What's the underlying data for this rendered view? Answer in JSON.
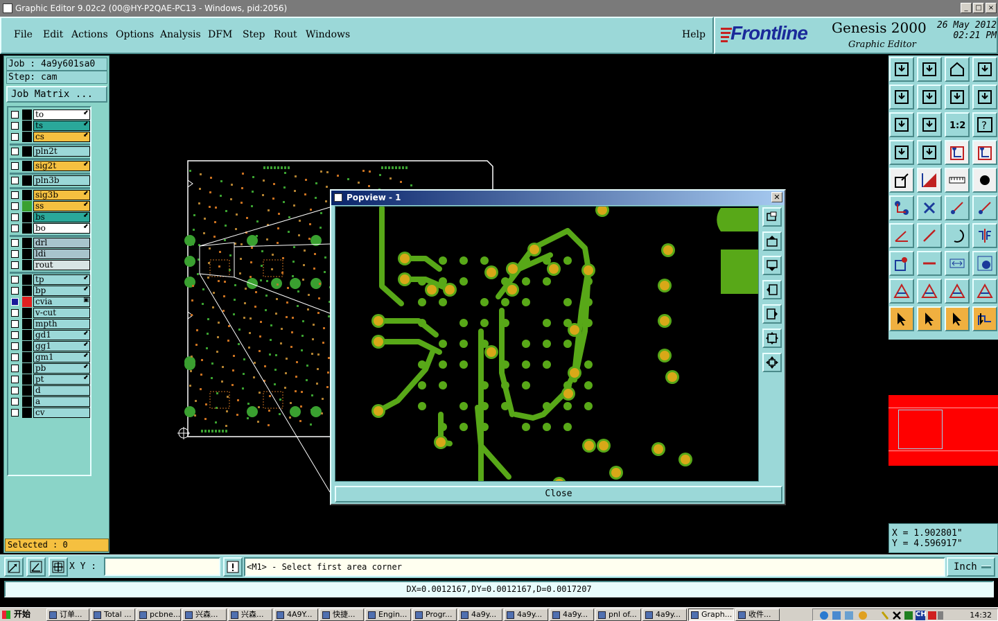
{
  "window": {
    "title": "Graphic Editor 9.02c2 (00@HY-P2QAE-PC13 - Windows, pid:2056)",
    "controls": [
      "_",
      "□",
      "×"
    ]
  },
  "menu": {
    "items": [
      "File",
      "Edit",
      "Actions",
      "Options",
      "Analysis",
      "DFM",
      "Step",
      "Rout",
      "Windows"
    ],
    "help": "Help"
  },
  "brand": {
    "logo": "Frontline",
    "product": "Genesis 2000",
    "subtitle": "Graphic Editor",
    "date": "26 May 2012",
    "time": "02:21 PM"
  },
  "job": {
    "job_label": "Job : 4a9y601sa0",
    "step_label": "Step: cam",
    "matrix_button": "Job Matrix ..."
  },
  "layers": [
    {
      "name": "to",
      "color": "#ffffff",
      "sw": "#000000",
      "arrow": true
    },
    {
      "name": "ts",
      "color": "#2aa89a",
      "sw": "#000000",
      "arrow": true
    },
    {
      "name": "cs",
      "color": "#f5c040",
      "sw": "#000000",
      "arrow": true
    },
    {
      "name": "pln2t",
      "color": "#9bd8d8",
      "sw": "#000000",
      "arrow": false
    },
    {
      "name": "sig2t",
      "color": "#f5c040",
      "sw": "#000000",
      "arrow": true
    },
    {
      "name": "pln3b",
      "color": "#9bd8d8",
      "sw": "#000000",
      "arrow": false
    },
    {
      "name": "sig3b",
      "color": "#f5c040",
      "sw": "#000000",
      "arrow": true
    },
    {
      "name": "ss",
      "color": "#f5c040",
      "sw": "#3aa030",
      "arrow": true
    },
    {
      "name": "bs",
      "color": "#2aa89a",
      "sw": "#000000",
      "arrow": true
    },
    {
      "name": "bo",
      "color": "#ffffff",
      "sw": "#000000",
      "arrow": true
    },
    {
      "name": "drl",
      "color": "#a8c4cc",
      "sw": "#000000",
      "arrow": false
    },
    {
      "name": "ldi",
      "color": "#a8c4cc",
      "sw": "#000000",
      "arrow": false
    },
    {
      "name": "rout",
      "color": "#d8e4e4",
      "sw": "#000000",
      "arrow": false
    },
    {
      "name": "tp",
      "color": "#9bd8d8",
      "sw": "#000000",
      "arrow": true
    },
    {
      "name": "bp",
      "color": "#9bd8d8",
      "sw": "#000000",
      "arrow": true
    },
    {
      "name": "cvia",
      "color": "#9bd8d8",
      "sw": "#e02020",
      "arrow": true,
      "active": true
    },
    {
      "name": "v-cut",
      "color": "#9bd8d8",
      "sw": "#000000",
      "arrow": false
    },
    {
      "name": "mpth",
      "color": "#9bd8d8",
      "sw": "#000000",
      "arrow": false
    },
    {
      "name": "gd1",
      "color": "#9bd8d8",
      "sw": "#000000",
      "arrow": true
    },
    {
      "name": "gg1",
      "color": "#9bd8d8",
      "sw": "#000000",
      "arrow": true
    },
    {
      "name": "gm1",
      "color": "#9bd8d8",
      "sw": "#000000",
      "arrow": true
    },
    {
      "name": "pb",
      "color": "#9bd8d8",
      "sw": "#000000",
      "arrow": true
    },
    {
      "name": "pt",
      "color": "#9bd8d8",
      "sw": "#000000",
      "arrow": true
    },
    {
      "name": "d",
      "color": "#9bd8d8",
      "sw": "#000000",
      "arrow": false
    },
    {
      "name": "a",
      "color": "#9bd8d8",
      "sw": "#000000",
      "arrow": false
    },
    {
      "name": "cv",
      "color": "#9bd8d8",
      "sw": "#000000",
      "arrow": false
    }
  ],
  "selected": "Selected : 0",
  "popview": {
    "title": "Popview - 1",
    "close_button": "Close"
  },
  "coords": {
    "x": "X = 1.902801\"",
    "y": "Y = 4.596917\""
  },
  "command": {
    "xy_label": "X Y :",
    "xy_value": "",
    "prompt": "<M1> - Select first area corner",
    "units": "Inch"
  },
  "measure": "DX=0.0012167,DY=0.0012167,D=0.0017207",
  "taskbar": {
    "start": "开始",
    "items": [
      "订单...",
      "Total ...",
      "pcbne...",
      "兴森...",
      "兴森...",
      "4A9Y...",
      "快捷...",
      "Engin...",
      "Progr...",
      "4a9y...",
      "4a9y...",
      "4a9y...",
      "pnl of...",
      "4a9y...",
      "Graph...",
      "收件..."
    ],
    "active_index": 14,
    "lang": "CH",
    "clock": "14:32"
  },
  "colors": {
    "panel": "#9bd8d8",
    "trace": "#58a818",
    "pad": "#d8a818",
    "board_outline": "#ffffff",
    "overview_fill": "#ff0000"
  }
}
